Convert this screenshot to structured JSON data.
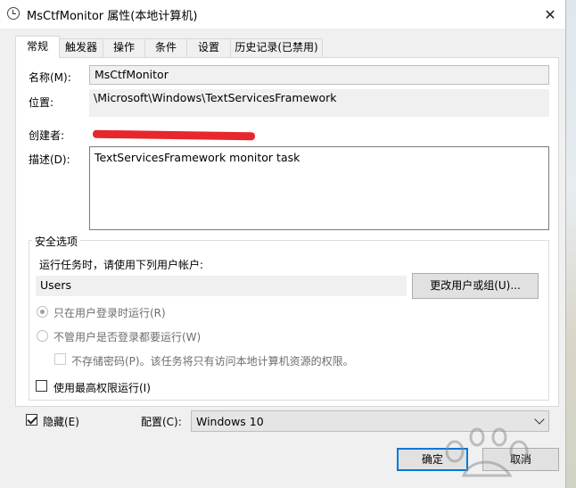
{
  "window": {
    "title": "MsCtfMonitor 属性(本地计算机)",
    "close_glyph": "✕"
  },
  "tabs": [
    {
      "label": "常规",
      "active": true
    },
    {
      "label": "触发器",
      "active": false
    },
    {
      "label": "操作",
      "active": false
    },
    {
      "label": "条件",
      "active": false
    },
    {
      "label": "设置",
      "active": false
    },
    {
      "label": "历史记录(已禁用)",
      "active": false
    }
  ],
  "general": {
    "name_label": "名称(M):",
    "name_value": "MsCtfMonitor",
    "location_label": "位置:",
    "location_value": "\\Microsoft\\Windows\\TextServicesFramework",
    "author_label": "创建者:",
    "author_value": "[redacted]",
    "description_label": "描述(D):",
    "description_value": "TextServicesFramework monitor task"
  },
  "security": {
    "group_title": "安全选项",
    "run_as_label": "运行任务时，请使用下列用户帐户:",
    "user_account": "Users",
    "change_user_button": "更改用户或组(U)...",
    "option_logged_on": "只在用户登录时运行(R)",
    "option_whether_logged": "不管用户是否登录都要运行(W)",
    "option_no_store_password": "不存储密码(P)。该任务将只有访问本地计算机资源的权限。",
    "option_highest_privileges": "使用最高权限运行(I)"
  },
  "footer": {
    "hidden_label": "隐藏(E)",
    "hidden_checked": true,
    "configure_label": "配置(C):",
    "configure_value": "Windows 10",
    "ok_button": "确定",
    "cancel_button": "取消"
  },
  "colors": {
    "focus_border": "#0078d7",
    "redaction": "#e8262d"
  }
}
